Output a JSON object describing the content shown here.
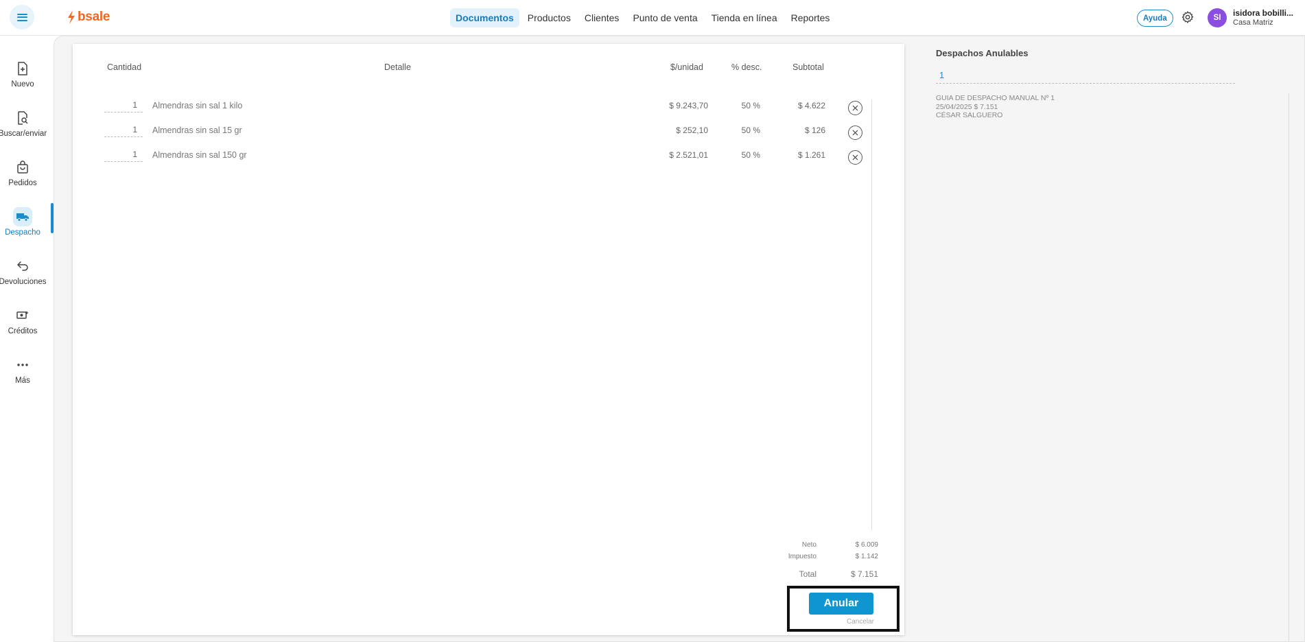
{
  "brand": {
    "name": "bsale",
    "color": "#f26722"
  },
  "topnav": {
    "items": [
      "Documentos",
      "Productos",
      "Clientes",
      "Punto de venta",
      "Tienda en línea",
      "Reportes"
    ],
    "active": "Documentos"
  },
  "header": {
    "help_label": "Ayuda",
    "avatar_initials": "SI",
    "user_name": "isidora bobilli...",
    "branch": "Casa Matriz"
  },
  "sidebar": {
    "items": [
      {
        "label": "Nuevo",
        "icon": "new-document-icon"
      },
      {
        "label": "Buscar/enviar",
        "icon": "search-document-icon"
      },
      {
        "label": "Pedidos",
        "icon": "shopping-bag-icon"
      },
      {
        "label": "Despacho",
        "icon": "truck-icon"
      },
      {
        "label": "Devoluciones",
        "icon": "return-arrow-icon"
      },
      {
        "label": "Créditos",
        "icon": "credit-icon"
      },
      {
        "label": "Más",
        "icon": "more-dots-icon"
      }
    ],
    "active": "Despacho"
  },
  "table": {
    "headers": {
      "qty": "Cantidad",
      "detail": "Detalle",
      "unit_price": "$/unidad",
      "discount": "% desc.",
      "subtotal": "Subtotal"
    },
    "rows": [
      {
        "qty": "1",
        "detail": "Almendras sin sal 1 kilo",
        "unit_price": "$ 9.243,70",
        "discount": "50 %",
        "subtotal": "$ 4.622"
      },
      {
        "qty": "1",
        "detail": "Almendras sin sal 15 gr",
        "unit_price": "$ 252,10",
        "discount": "50 %",
        "subtotal": "$ 126"
      },
      {
        "qty": "1",
        "detail": "Almendras sin sal 150 gr",
        "unit_price": "$ 2.521,01",
        "discount": "50 %",
        "subtotal": "$ 1.261"
      }
    ]
  },
  "totals": {
    "neto_label": "Neto",
    "neto_value": "$ 6.009",
    "tax_label": "Impuesto",
    "tax_value": "$ 1.142",
    "total_label": "Total",
    "total_value": "$ 7.151"
  },
  "actions": {
    "void_label": "Anular",
    "cancel_label": "Cancelar"
  },
  "right_panel": {
    "title": "Despachos Anulables",
    "search_value": "1",
    "entry": {
      "line1": "GUIA DE DESPACHO MANUAL Nº 1",
      "line2": "25/04/2025 $ 7.151",
      "line3": "CÉSAR SALGUERO"
    }
  },
  "colors": {
    "accent": "#1a8ccc",
    "button": "#0f95cf",
    "avatar": "#8b4ee0"
  }
}
